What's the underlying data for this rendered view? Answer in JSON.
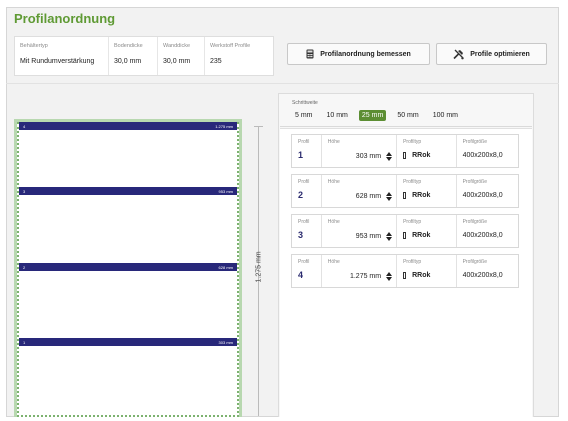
{
  "title": "Profilanordnung",
  "params": {
    "behaeltertyp_label": "Behältertyp",
    "behaeltertyp_value": "Mit Rundumverstärkung",
    "bodendicke_label": "Bodendicke",
    "bodendicke_value": "30,0 mm",
    "wanddicke_label": "Wanddicke",
    "wanddicke_value": "30,0 mm",
    "werkstoff_label": "Werkstoff Profile",
    "werkstoff_value": "235"
  },
  "buttons": {
    "bemessen_label": "Profilanordnung bemessen",
    "optimieren_label": "Profile optimieren"
  },
  "drawing": {
    "bands": [
      {
        "num": "4",
        "label": "1.275 mm"
      },
      {
        "num": "3",
        "label": "953 mm"
      },
      {
        "num": "2",
        "label": "628 mm"
      },
      {
        "num": "1",
        "label": "303 mm"
      }
    ],
    "dimension_label": "1.275 mm"
  },
  "schrittweite": {
    "label": "Schrittweite",
    "options": [
      "5 mm",
      "10 mm",
      "25 mm",
      "50 mm",
      "100 mm"
    ],
    "selected": "25 mm"
  },
  "columns": {
    "profil": "Profil",
    "hoehe": "Höhe",
    "profiltyp": "Profiltyp",
    "profilgroesse": "Profilgröße"
  },
  "profiles": [
    {
      "profil": "1",
      "hoehe": "303 mm",
      "profiltyp": "RRok",
      "profilgroesse": "400x200x8,0"
    },
    {
      "profil": "2",
      "hoehe": "628 mm",
      "profiltyp": "RRok",
      "profilgroesse": "400x200x8,0"
    },
    {
      "profil": "3",
      "hoehe": "953 mm",
      "profiltyp": "RRok",
      "profilgroesse": "400x200x8,0"
    },
    {
      "profil": "4",
      "hoehe": "1.275 mm",
      "profiltyp": "RRok",
      "profilgroesse": "400x200x8,0"
    }
  ],
  "colors": {
    "accent": "#5f9a34",
    "band": "#28287a",
    "border_green": "#7cb26f"
  }
}
